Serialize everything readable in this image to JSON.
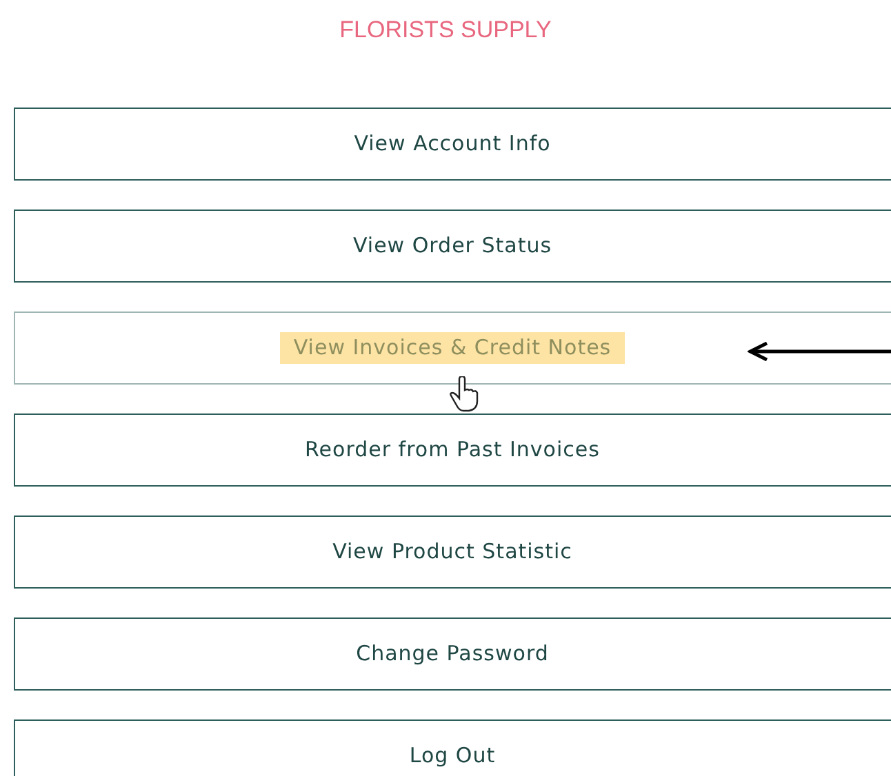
{
  "title": "FLORISTS SUPPLY",
  "menu": [
    {
      "label": "View Account Info",
      "hovered": false
    },
    {
      "label": "View Order Status",
      "hovered": false
    },
    {
      "label": "View Invoices & Credit Notes",
      "hovered": true
    },
    {
      "label": "Reorder from Past Invoices",
      "hovered": false
    },
    {
      "label": "View Product Statistic",
      "hovered": false
    },
    {
      "label": "Change Password",
      "hovered": false
    },
    {
      "label": "Log Out",
      "hovered": false
    }
  ]
}
